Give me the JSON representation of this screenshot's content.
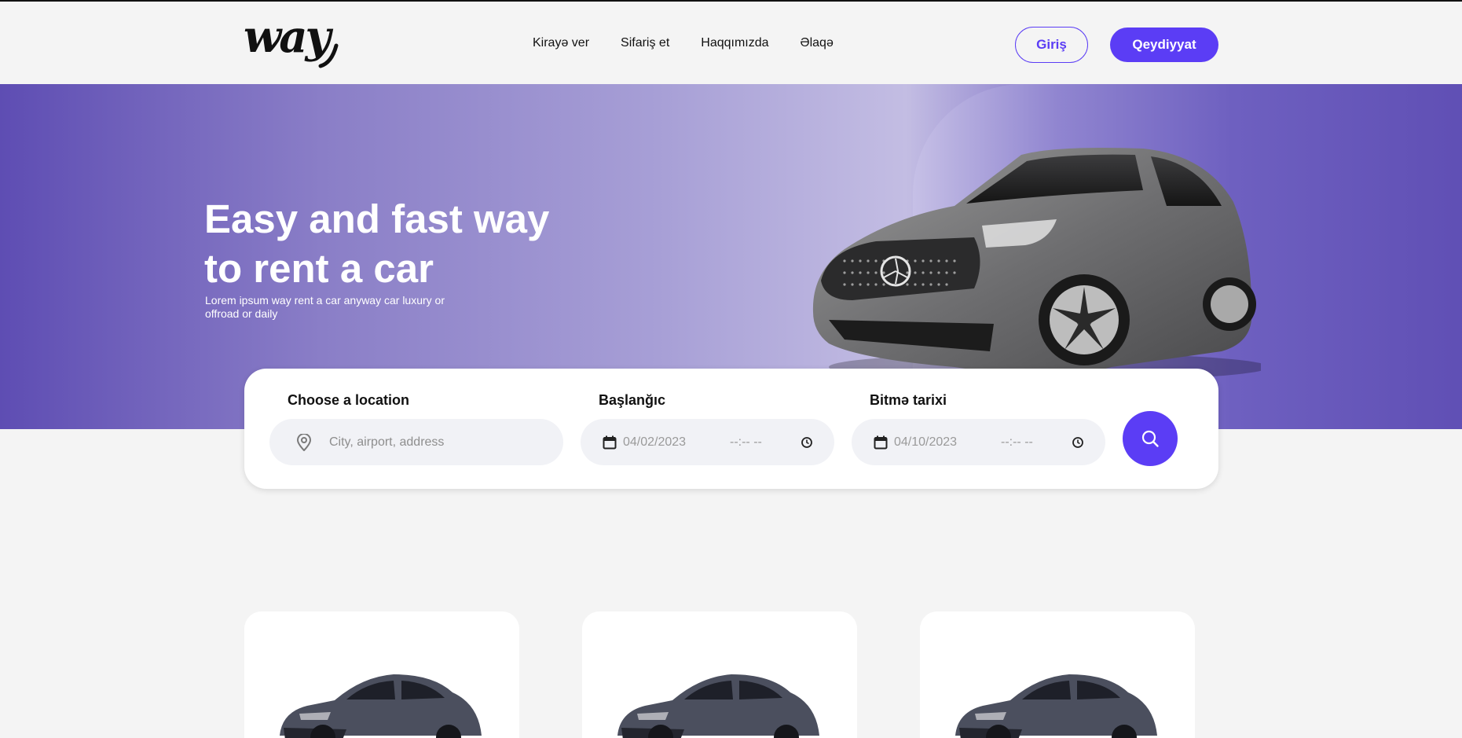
{
  "brand": {
    "logo_text": "way"
  },
  "nav": {
    "items": [
      {
        "label": "Kirayə ver"
      },
      {
        "label": "Sifariş et"
      },
      {
        "label": "Haqqımızda"
      },
      {
        "label": "Əlaqə"
      }
    ],
    "login_label": "Giriş",
    "register_label": "Qeydiyyat"
  },
  "hero": {
    "title_line1": "Easy and fast way",
    "title_line2": "to rent a car",
    "subtitle_line1": "Lorem ipsum way rent a car anyway car luxury or",
    "subtitle_line2": "offroad or daily"
  },
  "search": {
    "location": {
      "label": "Choose a location",
      "placeholder": "City, airport, address"
    },
    "start": {
      "label": "Başlanğıc",
      "date_placeholder": "04/02/2023",
      "time_placeholder": "--:-- --"
    },
    "end": {
      "label": "Bitmə tarixi",
      "date_placeholder": "04/10/2023",
      "time_placeholder": "--:-- --"
    }
  },
  "colors": {
    "accent": "#5b3df5",
    "hero_purple": "#5e4db3",
    "background": "#f4f4f4"
  },
  "icons": {
    "location": "map-pin-icon",
    "calendar": "calendar-icon",
    "clock": "clock-icon",
    "search": "search-icon"
  }
}
